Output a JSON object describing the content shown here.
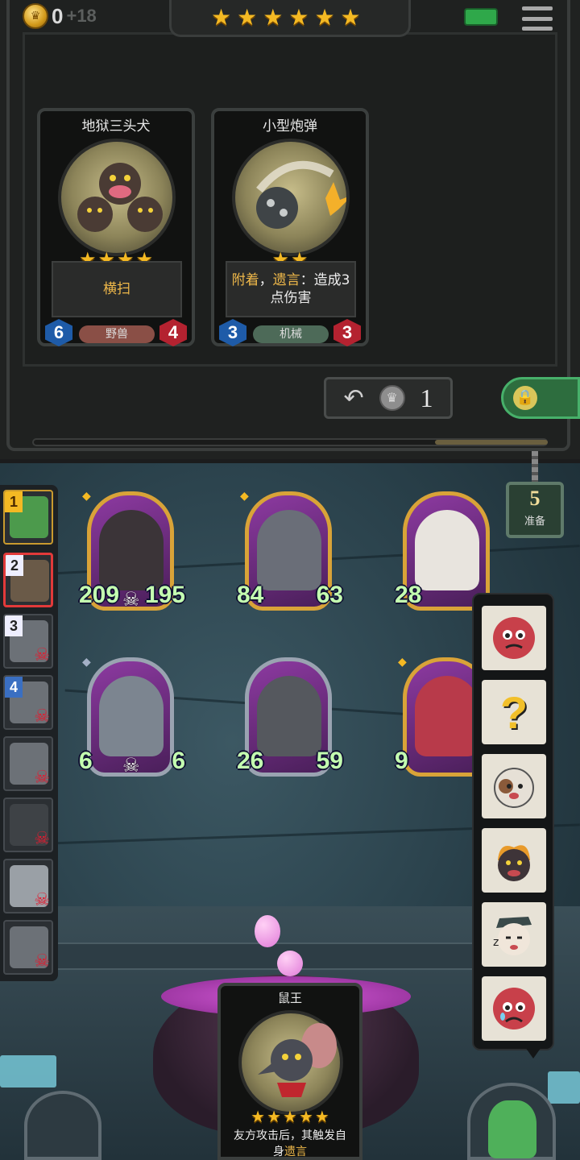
{
  "header": {
    "gold": "0",
    "gold_income": "+18",
    "tier_stars": [
      "★",
      "★",
      "★",
      "★",
      "★",
      "★"
    ],
    "menu_icon": "hamburger-icon"
  },
  "shop": {
    "cards": [
      {
        "name": "地狱三头犬",
        "stars": [
          "★",
          "★",
          "★",
          "★"
        ],
        "description": "横扫",
        "tribe": "野兽",
        "tribe_color": "#8a4f46",
        "attack": "6",
        "health": "4"
      },
      {
        "name": "小型炮弹",
        "stars": [
          "★",
          "★"
        ],
        "description_keyword_1": "附着",
        "description_sep": "，",
        "description_keyword_2": "遗言",
        "description_rest": "：造成3点伤害",
        "tribe": "机械",
        "tribe_color": "#4d6a58",
        "attack": "3",
        "health": "3"
      }
    ],
    "refresh_cost": "1",
    "refresh_progress": 0.22
  },
  "board": {
    "ready": {
      "count": "5",
      "label": "准备"
    },
    "players": [
      {
        "rank": "1",
        "alive": true,
        "selected": false
      },
      {
        "rank": "2",
        "alive": true,
        "selected": true
      },
      {
        "rank": "3",
        "alive": false,
        "selected": false
      },
      {
        "rank": "4",
        "alive": false,
        "selected": false
      },
      {
        "rank": "",
        "alive": false,
        "selected": false
      },
      {
        "rank": "",
        "alive": false,
        "selected": false
      },
      {
        "rank": "",
        "alive": false,
        "selected": false
      },
      {
        "rank": "",
        "alive": false,
        "selected": false
      }
    ],
    "minions": [
      {
        "attack": "209",
        "health": "195",
        "frame": "gold",
        "skull": true
      },
      {
        "attack": "84",
        "health": "63",
        "frame": "gold",
        "skull": false
      },
      {
        "attack": "28",
        "health": "",
        "frame": "gold",
        "skull": false
      },
      {
        "attack": "6",
        "health": "6",
        "frame": "silver",
        "skull": true
      },
      {
        "attack": "26",
        "health": "59",
        "frame": "silver",
        "skull": false
      },
      {
        "attack": "9",
        "health": "",
        "frame": "gold",
        "skull": false
      }
    ],
    "emotes": [
      "angry-face-emote",
      "question-mark-emote",
      "dog-face-emote",
      "fire-dog-emote",
      "sleeping-face-emote",
      "crying-face-emote"
    ]
  },
  "hero": {
    "name": "鼠王",
    "stars": [
      "★",
      "★",
      "★",
      "★",
      "★"
    ],
    "desc_text": "友方攻击后，其触发自身",
    "desc_keyword": "遗言"
  }
}
